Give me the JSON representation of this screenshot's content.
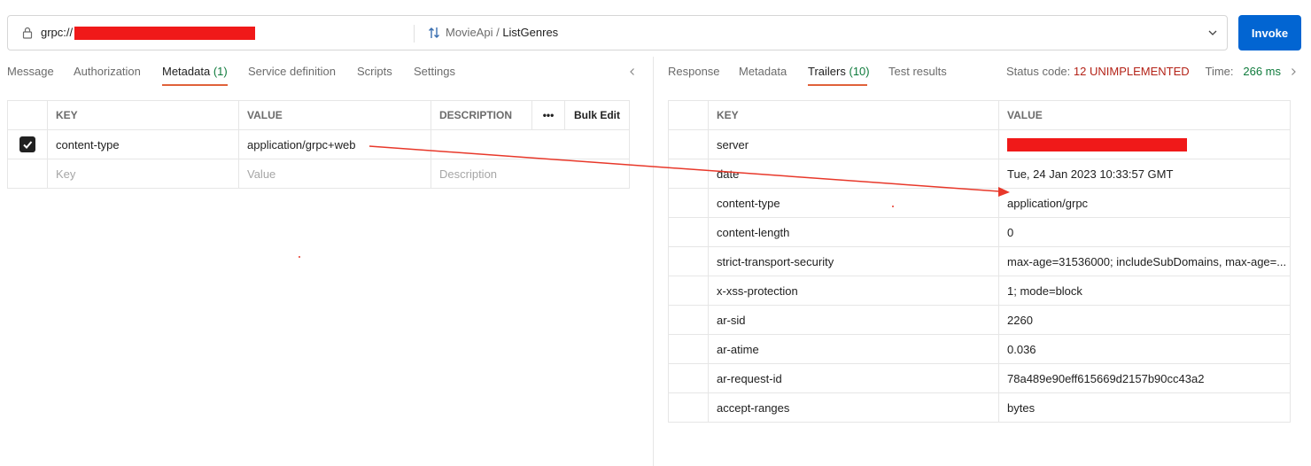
{
  "request": {
    "url_prefix": "grpc://",
    "method_service": "MovieApi / ",
    "method_name": "ListGenres",
    "invoke_label": "Invoke"
  },
  "request_tabs": [
    {
      "label": "Message"
    },
    {
      "label": "Authorization"
    },
    {
      "label": "Metadata",
      "count": "(1)"
    },
    {
      "label": "Service definition"
    },
    {
      "label": "Scripts"
    },
    {
      "label": "Settings"
    }
  ],
  "response_tabs": [
    {
      "label": "Response"
    },
    {
      "label": "Metadata"
    },
    {
      "label": "Trailers",
      "count": "(10)"
    },
    {
      "label": "Test results"
    }
  ],
  "status": {
    "code_label": "Status code:",
    "code_value": "12 UNIMPLEMENTED",
    "time_label": "Time:",
    "time_value": "266 ms"
  },
  "metadata_table": {
    "headers": {
      "key": "KEY",
      "value": "VALUE",
      "description": "DESCRIPTION",
      "more": "•••",
      "bulk_edit": "Bulk Edit"
    },
    "row": {
      "key": "content-type",
      "value": "application/grpc+web",
      "checked": true
    },
    "placeholders": {
      "key": "Key",
      "value": "Value",
      "description": "Description"
    }
  },
  "trailers_table": {
    "headers": {
      "key": "KEY",
      "value": "VALUE"
    },
    "rows": [
      {
        "key": "server",
        "value": ""
      },
      {
        "key": "date",
        "value": "Tue, 24 Jan 2023 10:33:57 GMT"
      },
      {
        "key": "content-type",
        "value": "application/grpc"
      },
      {
        "key": "content-length",
        "value": "0"
      },
      {
        "key": "strict-transport-security",
        "value": "max-age=31536000; includeSubDomains, max-age=..."
      },
      {
        "key": "x-xss-protection",
        "value": "1; mode=block"
      },
      {
        "key": "ar-sid",
        "value": "2260"
      },
      {
        "key": "ar-atime",
        "value": "0.036"
      },
      {
        "key": "ar-request-id",
        "value": "78a489e90eff615669d2157b90cc43a2"
      },
      {
        "key": "accept-ranges",
        "value": "bytes"
      }
    ]
  },
  "colors": {
    "accent": "#e0613a",
    "invoke": "#0265d2",
    "redaction": "#f01919",
    "status_error": "#b42318",
    "status_ok": "#0f7b3c"
  }
}
